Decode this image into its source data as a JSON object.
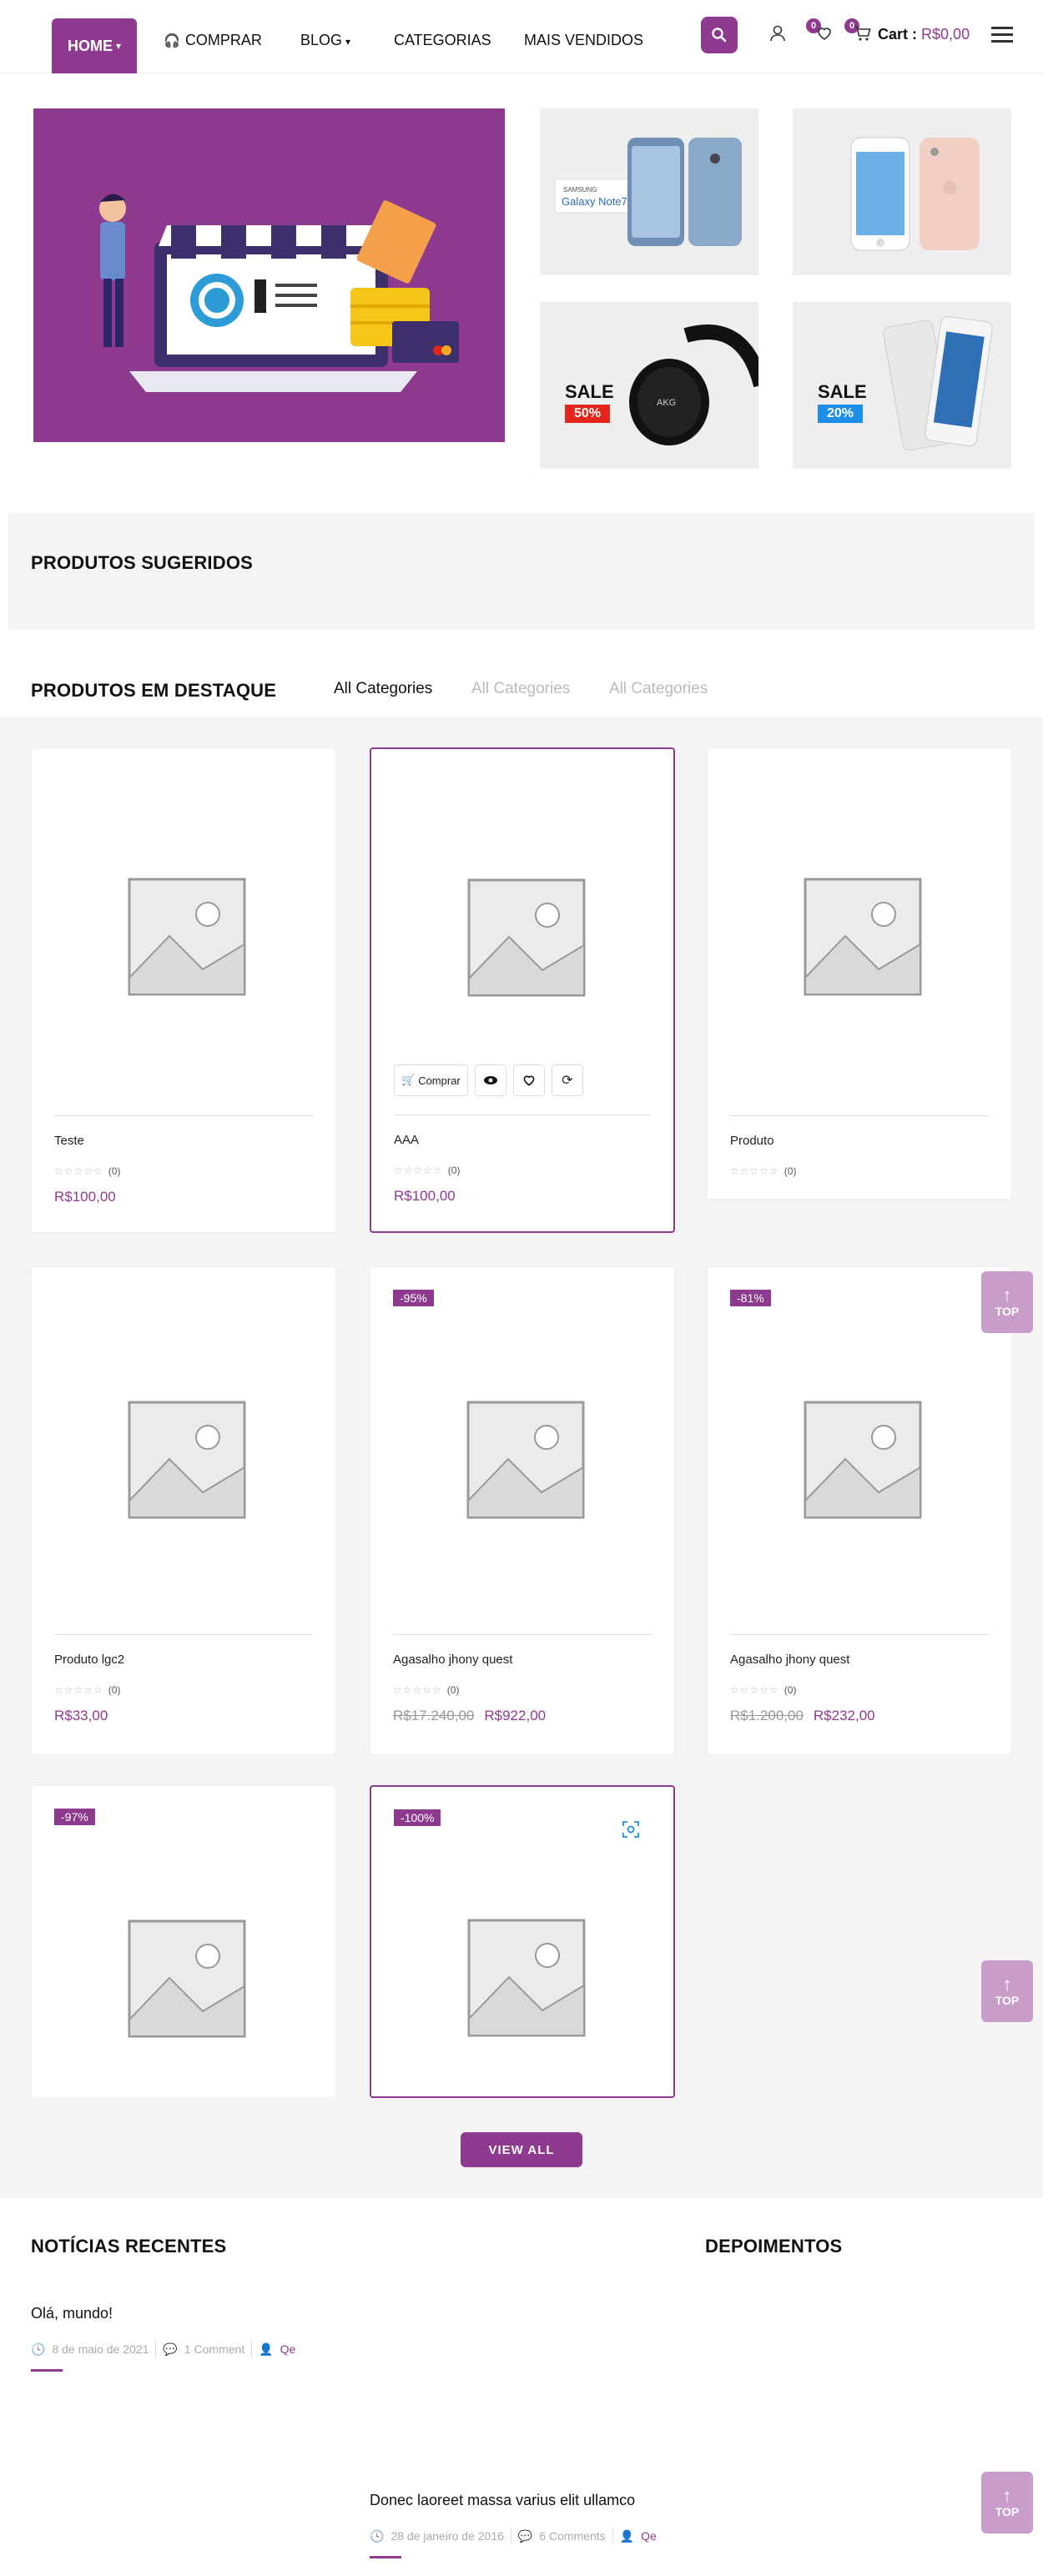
{
  "header": {
    "nav": {
      "home": "HOME",
      "comprar": "COMPRAR",
      "blog": "BLOG",
      "categorias": "CATEGORIAS",
      "mais_vendidos": "MAIS VENDIDOS"
    },
    "wishlist_count": "0",
    "cart_count": "0",
    "cart_label": "Cart :",
    "cart_amount": "R$0,00"
  },
  "hero": {
    "tiles": [
      {
        "product": "Samsung Galaxy Note7",
        "brand_text": "SAMSUNG",
        "model_text": "Galaxy Note7"
      },
      {
        "product": "iPhone"
      },
      {
        "product": "AKG headphones",
        "sale_label": "SALE",
        "sale_percent": "50%",
        "sale_color": "#e3261c"
      },
      {
        "product": "Google Pixel",
        "sale_label": "SALE",
        "sale_percent": "20%",
        "sale_color": "#1f8ee8"
      }
    ]
  },
  "sections": {
    "suggested": "PRODUTOS SUGERIDOS",
    "featured": "PRODUTOS EM DESTAQUE",
    "category_tabs": [
      "All Categories",
      "All Categories",
      "All Categories"
    ],
    "news": "NOTÍCIAS RECENTES",
    "testimonials": "DEPOIMENTOS",
    "view_all": "VIEW ALL"
  },
  "product_actions": {
    "buy": "Comprar"
  },
  "products": [
    {
      "name": "Teste",
      "rating_count": "(0)",
      "price": "R$100,00",
      "old_price": "",
      "discount": ""
    },
    {
      "name": "AAA",
      "rating_count": "(0)",
      "price": "R$100,00",
      "old_price": "",
      "discount": ""
    },
    {
      "name": "Produto",
      "rating_count": "(0)",
      "price": "",
      "old_price": "",
      "discount": ""
    },
    {
      "name": "Produto lgc2",
      "rating_count": "(0)",
      "price": "R$33,00",
      "old_price": "",
      "discount": ""
    },
    {
      "name": "Agasalho jhony quest",
      "rating_count": "(0)",
      "price": "R$922,00",
      "old_price": "R$17.240,00",
      "discount": "-95%"
    },
    {
      "name": "Agasalho jhony quest",
      "rating_count": "(0)",
      "price": "R$232,00",
      "old_price": "R$1.200,00",
      "discount": "-81%"
    },
    {
      "name": "",
      "rating_count": "",
      "price": "",
      "old_price": "",
      "discount": "-97%"
    },
    {
      "name": "",
      "rating_count": "",
      "price": "",
      "old_price": "",
      "discount": "-100%"
    }
  ],
  "top_button": "TOP",
  "news": [
    {
      "title": "Olá, mundo!",
      "date": "8 de maio de 2021",
      "comments": "1 Comment",
      "author": "Qe"
    },
    {
      "title": "Donec laoreet massa varius elit ullamco",
      "date": "28 de janeiro de 2016",
      "comments": "6 Comments",
      "author": "Qe"
    }
  ],
  "colors": {
    "accent": "#8e3b8f",
    "top_button": "#c89dca",
    "section_bg": "#f4f4f4"
  }
}
